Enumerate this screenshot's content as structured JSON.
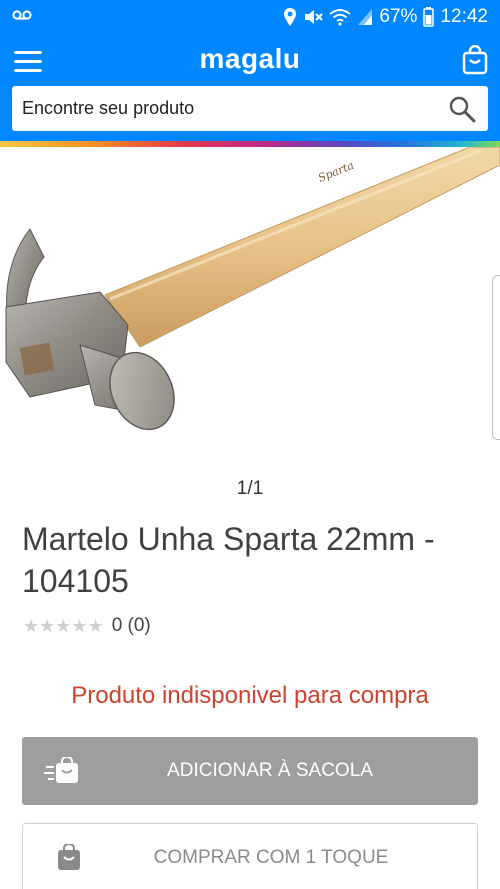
{
  "status_bar": {
    "battery": "67%",
    "time": "12:42",
    "icons": [
      "voicemail-icon",
      "location-icon",
      "mute-icon",
      "wifi-icon",
      "signal-icon",
      "battery-icon"
    ]
  },
  "header": {
    "brand": "magalu",
    "background_color": "#0086ff",
    "icons": [
      "menu-icon",
      "shopping-bag-icon"
    ]
  },
  "search": {
    "placeholder": "Encontre seu produto",
    "value": "",
    "icon": "search-icon"
  },
  "product": {
    "image_pager": "1/1",
    "title": "Martelo Unha Sparta 22mm - 104105",
    "rating": {
      "stars": 0,
      "max": 5,
      "text": "0 (0)"
    },
    "availability": "Produto indisponivel para compra",
    "availability_color": "#d0412e"
  },
  "actions": {
    "add_to_bag_label": "ADICIONAR À SACOLA",
    "buy_one_tap_label": "COMPRAR COM 1 TOQUE"
  }
}
